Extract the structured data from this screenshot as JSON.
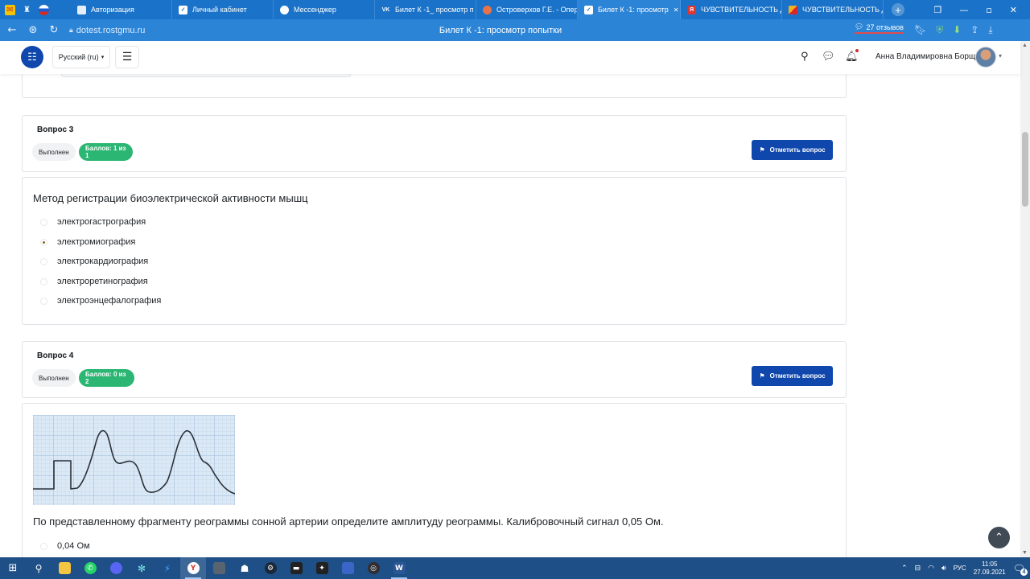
{
  "browser": {
    "tabs": [
      {
        "title": "Авторизация",
        "icon": "gosuslugi-icon",
        "color": "#e8eef6"
      },
      {
        "title": "Личный кабинет",
        "icon": "checkmark-shield-icon",
        "color": "#ffffff"
      },
      {
        "title": "Мессенджер",
        "icon": "chat-bubble-icon",
        "color": "#ffffff"
      },
      {
        "title": "Билет К -1_ просмотр п",
        "icon": "vk-icon",
        "color": "#ffffff"
      },
      {
        "title": "Островерхов Г.Е. - Опер",
        "icon": "book-icon",
        "color": "#e8734a"
      },
      {
        "title": "Билет К -1: просмотр",
        "icon": "checkmark-shield-icon",
        "color": "#ffffff",
        "active": true
      },
      {
        "title": "ЧУВСТВИТЕЛЬНОСТЬ Д",
        "icon": "yandex-icon",
        "color": "#e03333"
      },
      {
        "title": "ЧУВСТВИТЕЛЬНОСТЬ Д",
        "icon": "colorful-book-icon",
        "color": "#f2b01e"
      }
    ],
    "close_glyph": "✕",
    "url": "dotest.rostgmu.ru",
    "page_title": "Билет К -1: просмотр попытки",
    "reviews_label": "27 отзывов"
  },
  "header": {
    "language": "Русский (ru)",
    "user_name": "Анна Владимировна Борщ"
  },
  "questions": [
    {
      "title": "Вопрос 3",
      "state": "Выполнен",
      "grade": "Баллов: 1 из 1",
      "flag_label": "Отметить вопрос",
      "text": "Метод регистрации биоэлектрической активности мышц",
      "answers": [
        {
          "label": "электрогастрография",
          "checked": false
        },
        {
          "label": "электромиография",
          "checked": true
        },
        {
          "label": "электрокардиография",
          "checked": false
        },
        {
          "label": "электроретинография",
          "checked": false
        },
        {
          "label": "электроэнцефалография",
          "checked": false
        }
      ]
    },
    {
      "title": "Вопрос 4",
      "state": "Выполнен",
      "grade": "Баллов: 0 из 2",
      "flag_label": "Отметить вопрос",
      "text": "По представленному фрагменту реограммы сонной артерии определите амплитуду реограммы. Калибровочный сигнал 0,05 Ом.",
      "answers": [
        {
          "label": "0,04 Ом",
          "checked": false
        }
      ]
    }
  ],
  "taskbar": {
    "language": "РУС",
    "time": "11:05",
    "date": "27.09.2021",
    "notification_count": "4"
  },
  "colors": {
    "browser_blue": "#1a73c9",
    "primary": "#0f47ad",
    "success": "#2bb673",
    "taskbar": "#1e4f86"
  }
}
